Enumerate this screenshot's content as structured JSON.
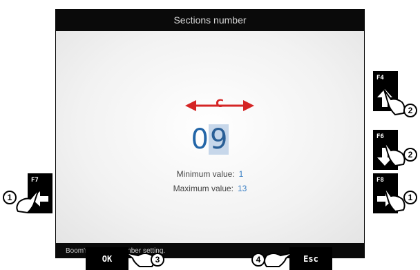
{
  "screen": {
    "title": "Sections number",
    "value_digits": [
      "0",
      "9"
    ],
    "marker_label": "C",
    "min_label": "Minimum value:",
    "min_value": "1",
    "max_label": "Maximum value:",
    "max_value": "13",
    "status": "Boom's sections number setting."
  },
  "keys": {
    "f4": "F4",
    "f6": "F6",
    "f7": "F7",
    "f8": "F8",
    "ok": "OK",
    "esc": "Esc"
  },
  "callouts": {
    "f7": "1",
    "f8": "1",
    "f4": "2",
    "f6": "2",
    "ok": "3",
    "esc": "4"
  },
  "colors": {
    "value": "#2366a8",
    "marker": "#d52525",
    "selected_bg": "#c7d7ea"
  }
}
